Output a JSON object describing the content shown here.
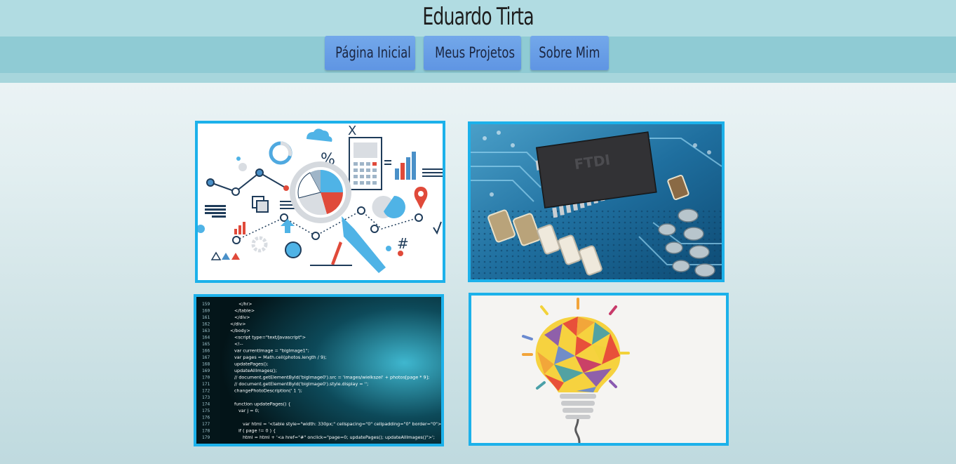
{
  "site": {
    "title": "Eduardo Tirta"
  },
  "nav": {
    "items": [
      {
        "label": "Página Inicial"
      },
      {
        "label": "Meus Projetos"
      },
      {
        "label": "Sobre Mim"
      }
    ]
  },
  "gallery": {
    "items": [
      {
        "subject": "data analysis infographic",
        "text": [
          "%",
          "X",
          "#"
        ]
      },
      {
        "subject": "circuit board microchip",
        "text": [
          "FTDI"
        ]
      },
      {
        "subject": "source code screen",
        "lines": [
          {
            "n": "159",
            "code": "</hr>"
          },
          {
            "n": "160",
            "code": "</table>"
          },
          {
            "n": "161",
            "code": "</div>"
          },
          {
            "n": "162",
            "code": "</div>"
          },
          {
            "n": "163",
            "code": "</body>"
          },
          {
            "n": "164",
            "code": "<script type=\"text/javascript\">"
          },
          {
            "n": "165",
            "code": "<!--"
          },
          {
            "n": "166",
            "code": "var currentImage = \"bigImage1\";"
          },
          {
            "n": "167",
            "code": "var pages = Math.ceil(photos.length / 9);"
          },
          {
            "n": "168",
            "code": "updatePages();"
          },
          {
            "n": "169",
            "code": "updateAllImages();"
          },
          {
            "n": "170",
            "code": "// document.getElementById('bigImage0').src = 'images/wielkszel' + photos[page * 9];"
          },
          {
            "n": "171",
            "code": "// document.getElementById('bigImage0').style.display = '';"
          },
          {
            "n": "172",
            "code": "changePhotoDescription(' 1 ');"
          },
          {
            "n": "173",
            "code": ""
          },
          {
            "n": "174",
            "code": "function updatePages() {"
          },
          {
            "n": "175",
            "code": "var j = 0;"
          },
          {
            "n": "176",
            "code": ""
          },
          {
            "n": "177",
            "code": "var html = '<table style=\"width: 330px;\" cellspacing=\"0\" cellpadding=\"0\" border=\"0\">';"
          },
          {
            "n": "178",
            "code": "if ( page != 0 ) {"
          },
          {
            "n": "179",
            "code": "html = html + '<a href=\"#\" onclick=\"page=0; updatePages(); updateAllImages()\">';"
          }
        ]
      },
      {
        "subject": "colorful light bulb"
      }
    ]
  },
  "colors": {
    "header_bg": "#b1dce2",
    "nav_bg": "#8fcbd4",
    "button_bg": "#6a9fe7",
    "card_border": "#1cb1ea"
  }
}
